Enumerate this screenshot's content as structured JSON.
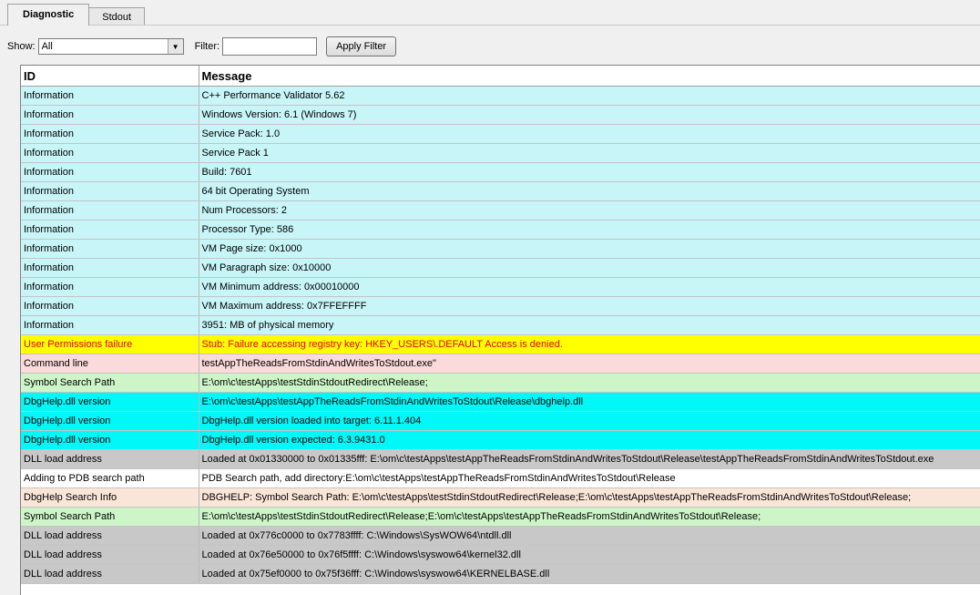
{
  "tabs": [
    {
      "label": "Diagnostic",
      "active": true
    },
    {
      "label": "Stdout",
      "active": false
    }
  ],
  "toolbar": {
    "show_label": "Show:",
    "show_value": "All",
    "filter_label": "Filter:",
    "filter_value": "",
    "apply_label": "Apply Filter"
  },
  "table": {
    "columns": [
      "ID",
      "Message"
    ],
    "rows": [
      {
        "id": "Information",
        "message": "C++ Performance Validator 5.62",
        "bg": "#c8f5f8",
        "fg": "#000000"
      },
      {
        "id": "Information",
        "message": "Windows Version: 6.1 (Windows 7)",
        "bg": "#c8f5f8",
        "fg": "#000000"
      },
      {
        "id": "Information",
        "message": "Service Pack: 1.0",
        "bg": "#c8f5f8",
        "fg": "#000000"
      },
      {
        "id": "Information",
        "message": "Service Pack 1",
        "bg": "#c8f5f8",
        "fg": "#000000"
      },
      {
        "id": "Information",
        "message": "Build: 7601",
        "bg": "#c8f5f8",
        "fg": "#000000"
      },
      {
        "id": "Information",
        "message": "64 bit Operating System",
        "bg": "#c8f5f8",
        "fg": "#000000"
      },
      {
        "id": "Information",
        "message": "Num Processors: 2",
        "bg": "#c8f5f8",
        "fg": "#000000"
      },
      {
        "id": "Information",
        "message": "Processor Type: 586",
        "bg": "#c8f5f8",
        "fg": "#000000"
      },
      {
        "id": "Information",
        "message": "VM Page size: 0x1000",
        "bg": "#c8f5f8",
        "fg": "#000000"
      },
      {
        "id": "Information",
        "message": "VM Paragraph size: 0x10000",
        "bg": "#c8f5f8",
        "fg": "#000000"
      },
      {
        "id": "Information",
        "message": "VM Minimum address: 0x00010000",
        "bg": "#c8f5f8",
        "fg": "#000000"
      },
      {
        "id": "Information",
        "message": "VM Maximum address: 0x7FFEFFFF",
        "bg": "#c8f5f8",
        "fg": "#000000"
      },
      {
        "id": "Information",
        "message": "3951: MB of physical memory",
        "bg": "#c8f5f8",
        "fg": "#000000"
      },
      {
        "id": "User Permissions failure",
        "message": "Stub: Failure accessing registry key: HKEY_USERS\\.DEFAULT   Access is denied.",
        "bg": "#ffff00",
        "fg": "#e00000"
      },
      {
        "id": "Command line",
        "message": "testAppTheReadsFromStdinAndWritesToStdout.exe\"",
        "bg": "#fadada",
        "fg": "#000000"
      },
      {
        "id": "Symbol Search Path",
        "message": "E:\\om\\c\\testApps\\testStdinStdoutRedirect\\Release;",
        "bg": "#cdf5c8",
        "fg": "#000000"
      },
      {
        "id": "DbgHelp.dll version",
        "message": "E:\\om\\c\\testApps\\testAppTheReadsFromStdinAndWritesToStdout\\Release\\dbghelp.dll",
        "bg": "#00f8f8",
        "fg": "#000000"
      },
      {
        "id": "DbgHelp.dll version",
        "message": "DbgHelp.dll version loaded into target: 6.11.1.404",
        "bg": "#00f8f8",
        "fg": "#000000"
      },
      {
        "id": "DbgHelp.dll version",
        "message": "DbgHelp.dll version expected: 6.3.9431.0",
        "bg": "#00f8f8",
        "fg": "#000000"
      },
      {
        "id": "DLL load address",
        "message": "Loaded at 0x01330000 to 0x01335fff: E:\\om\\c\\testApps\\testAppTheReadsFromStdinAndWritesToStdout\\Release\\testAppTheReadsFromStdinAndWritesToStdout.exe",
        "bg": "#c8c8c8",
        "fg": "#000000"
      },
      {
        "id": "Adding to PDB search path",
        "message": "PDB Search path, add directory:E:\\om\\c\\testApps\\testAppTheReadsFromStdinAndWritesToStdout\\Release",
        "bg": "#ffffff",
        "fg": "#000000"
      },
      {
        "id": "DbgHelp Search Info",
        "message": "DBGHELP: Symbol Search Path: E:\\om\\c\\testApps\\testStdinStdoutRedirect\\Release;E:\\om\\c\\testApps\\testAppTheReadsFromStdinAndWritesToStdout\\Release;",
        "bg": "#fae6d8",
        "fg": "#000000"
      },
      {
        "id": "Symbol Search Path",
        "message": "E:\\om\\c\\testApps\\testStdinStdoutRedirect\\Release;E:\\om\\c\\testApps\\testAppTheReadsFromStdinAndWritesToStdout\\Release;",
        "bg": "#cdf5c8",
        "fg": "#000000"
      },
      {
        "id": "DLL load address",
        "message": "Loaded at 0x776c0000 to 0x7783ffff: C:\\Windows\\SysWOW64\\ntdll.dll",
        "bg": "#c8c8c8",
        "fg": "#000000"
      },
      {
        "id": "DLL load address",
        "message": "Loaded at 0x76e50000 to 0x76f5ffff: C:\\Windows\\syswow64\\kernel32.dll",
        "bg": "#c8c8c8",
        "fg": "#000000"
      },
      {
        "id": "DLL load address",
        "message": "Loaded at 0x75ef0000 to 0x75f36fff: C:\\Windows\\syswow64\\KERNELBASE.dll",
        "bg": "#c8c8c8",
        "fg": "#000000"
      }
    ]
  }
}
